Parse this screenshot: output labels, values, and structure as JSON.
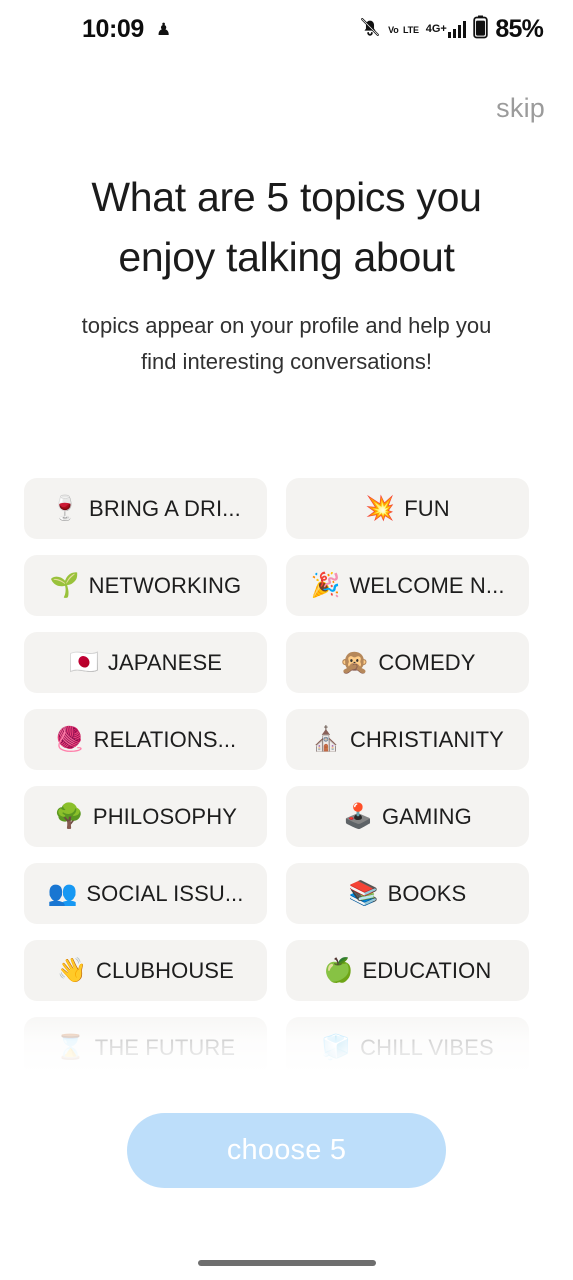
{
  "status_bar": {
    "time": "10:09",
    "app_icon": "♟",
    "notifications_muted_icon": "bell-muted-icon",
    "volte_line1": "Vo",
    "volte_line2": "LTE",
    "network_type": "4G+",
    "signal_bars": 4,
    "battery_percent": "85%"
  },
  "header": {
    "skip_label": "skip",
    "title_line1": "What are 5 topics you",
    "title_line2": "enjoy talking about",
    "subtitle_line1": "topics appear on your profile and help you",
    "subtitle_line2": "find interesting conversations!"
  },
  "topics": [
    {
      "emoji": "🍷",
      "label": "BRING A DRI...",
      "icon_name": "wine-glass-icon"
    },
    {
      "emoji": "💥",
      "label": "FUN",
      "icon_name": "collision-icon"
    },
    {
      "emoji": "🌱",
      "label": "NETWORKING",
      "icon_name": "seedling-icon"
    },
    {
      "emoji": "🎉",
      "label": "WELCOME N...",
      "icon_name": "party-popper-icon"
    },
    {
      "emoji": "🇯🇵",
      "label": "JAPANESE",
      "icon_name": "japan-flag-icon"
    },
    {
      "emoji": "🙊",
      "label": "COMEDY",
      "icon_name": "speak-no-evil-monkey-icon"
    },
    {
      "emoji": "🧶",
      "label": "RELATIONS...",
      "icon_name": "yarn-icon"
    },
    {
      "emoji": "⛪",
      "label": "CHRISTIANITY",
      "icon_name": "church-icon"
    },
    {
      "emoji": "🌳",
      "label": "PHILOSOPHY",
      "icon_name": "tree-icon"
    },
    {
      "emoji": "🕹️",
      "label": "GAMING",
      "icon_name": "joystick-icon"
    },
    {
      "emoji": "👥",
      "label": "SOCIAL ISSU...",
      "icon_name": "busts-in-silhouette-icon"
    },
    {
      "emoji": "📚",
      "label": "BOOKS",
      "icon_name": "books-icon"
    },
    {
      "emoji": "👋",
      "label": "CLUBHOUSE",
      "icon_name": "waving-hand-icon"
    },
    {
      "emoji": "🍏",
      "label": "EDUCATION",
      "icon_name": "green-apple-icon"
    },
    {
      "emoji": "⌛",
      "label": "THE FUTURE",
      "icon_name": "hourglass-icon"
    },
    {
      "emoji": "🧊",
      "label": "CHILL VIBES",
      "icon_name": "ice-cube-icon"
    }
  ],
  "cta": {
    "label": "choose 5"
  },
  "colors": {
    "chip_bg": "#f4f3f1",
    "chip_text": "#1d1d1d",
    "cta_bg": "#bddefa",
    "cta_text": "#ffffff",
    "skip_text": "#9b9b9b",
    "page_bg": "#ffffff"
  }
}
